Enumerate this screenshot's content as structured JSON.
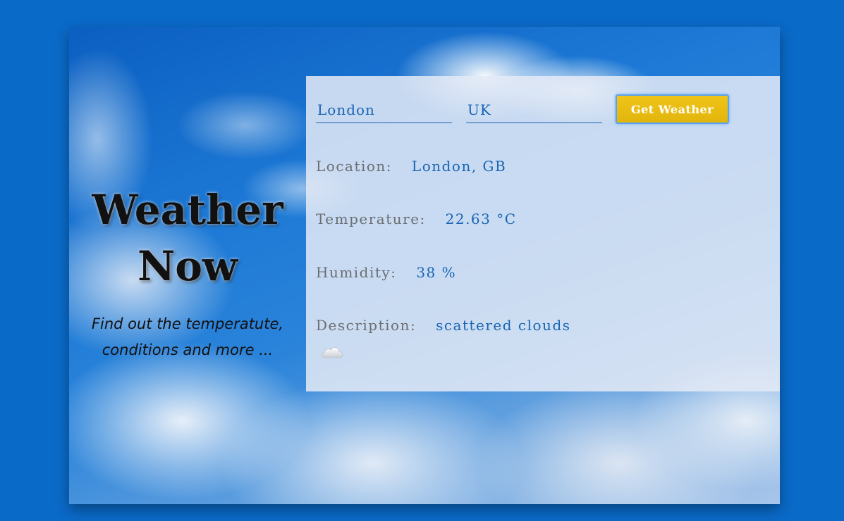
{
  "hero": {
    "title_line1": "Weather",
    "title_line2": "Now",
    "subtitle_line1": "Find out the temperatute,",
    "subtitle_line2": "conditions and more ..."
  },
  "form": {
    "city_value": "London",
    "country_value": "UK",
    "submit_label": "Get Weather"
  },
  "results": {
    "location_label": "Location:",
    "location_value": "London, GB",
    "temperature_label": "Temperature:",
    "temperature_value": "22.63 °C",
    "humidity_label": "Humidity:",
    "humidity_value": "38 %",
    "description_label": "Description:",
    "description_value": "scattered clouds",
    "icon": "cloud-icon"
  },
  "colors": {
    "page_background": "#0a6ac8",
    "accent_blue": "#1a65b3",
    "label_gray": "#6b6e73",
    "button_yellow": "#e8bb10",
    "panel": "rgba(228,234,246,0.86)"
  }
}
